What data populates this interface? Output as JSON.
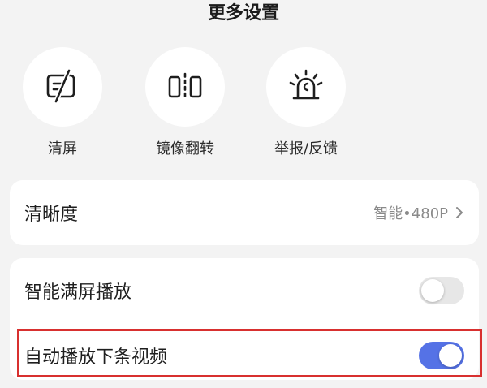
{
  "header": {
    "title": "更多设置"
  },
  "actions": [
    {
      "label": "清屏",
      "icon": "clear-screen-icon"
    },
    {
      "label": "镜像翻转",
      "icon": "mirror-flip-icon"
    },
    {
      "label": "举报/反馈",
      "icon": "report-siren-icon"
    }
  ],
  "settings": {
    "resolution": {
      "label": "清晰度",
      "value": "智能•480P",
      "icon": "chevron-right-icon"
    },
    "smart_fullscreen": {
      "label": "智能满屏播放",
      "enabled": false
    },
    "autoplay_next": {
      "label": "自动播放下条视频",
      "enabled": true
    }
  },
  "colors": {
    "toggle_on": "#5572e6",
    "toggle_off": "#e7e7e7",
    "highlight_border": "#d8302f",
    "background": "#f3f3f3"
  }
}
